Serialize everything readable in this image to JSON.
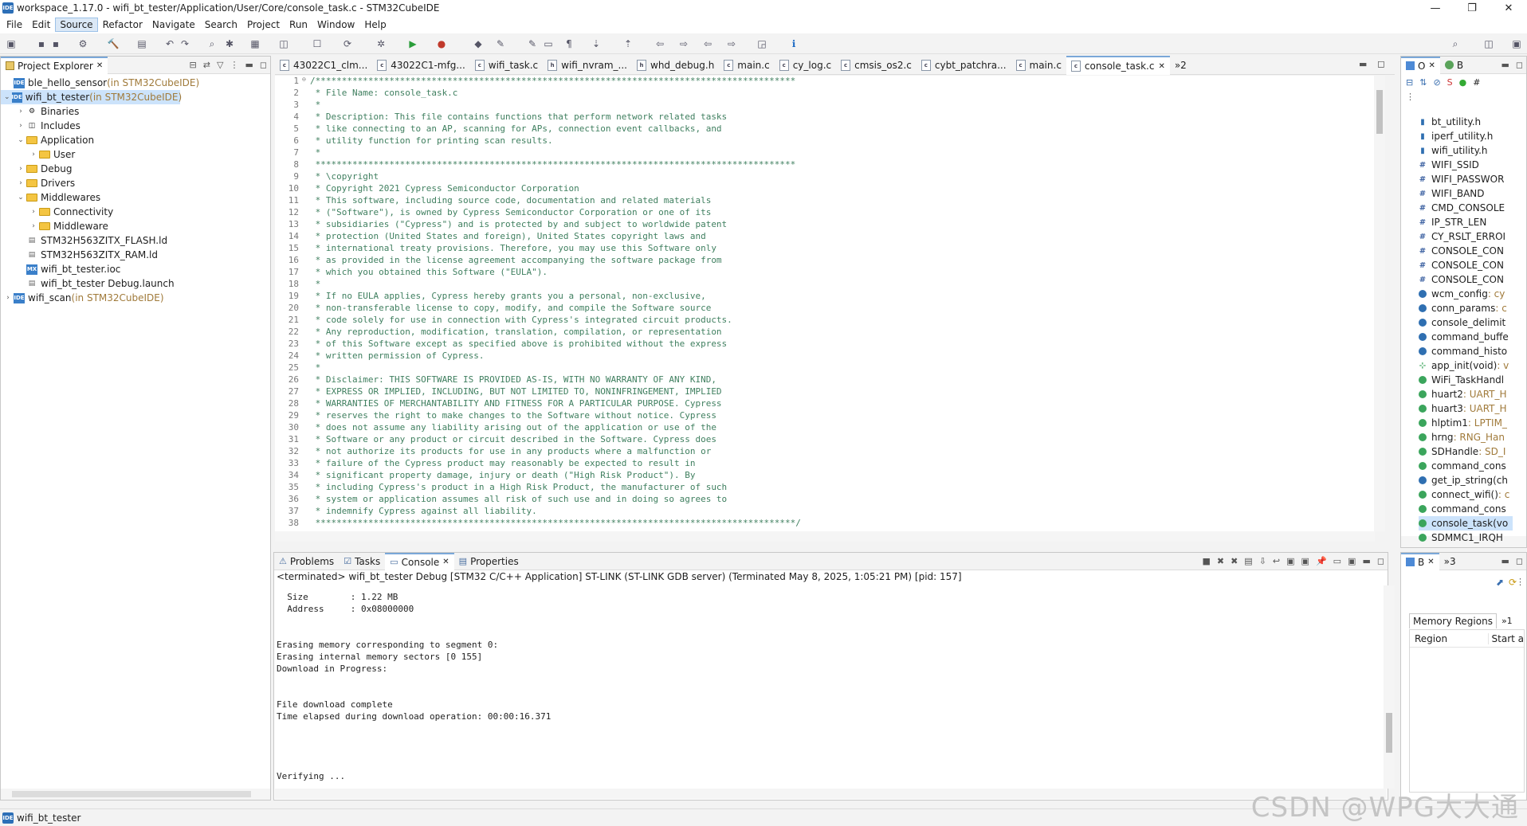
{
  "window": {
    "title": "workspace_1.17.0 - wifi_bt_tester/Application/User/Core/console_task.c - STM32CubeIDE",
    "app_badge": "IDE",
    "minimize": "—",
    "maximize": "❐",
    "close": "✕"
  },
  "menu": [
    "File",
    "Edit",
    "Source",
    "Refactor",
    "Navigate",
    "Search",
    "Project",
    "Run",
    "Window",
    "Help"
  ],
  "project_explorer": {
    "title": "Project Explorer",
    "items": [
      {
        "label": "ble_hello_sensor",
        "suffix": " (in STM32CubeIDE)",
        "depth": 0,
        "kind": "project",
        "expander": ""
      },
      {
        "label": "wifi_bt_tester",
        "suffix": " (in STM32CubeIDE)",
        "depth": 0,
        "kind": "project",
        "expander": "⌄",
        "selected": true
      },
      {
        "label": "Binaries",
        "suffix": "",
        "depth": 1,
        "kind": "bin",
        "expander": "›"
      },
      {
        "label": "Includes",
        "suffix": "",
        "depth": 1,
        "kind": "inc",
        "expander": "›"
      },
      {
        "label": "Application",
        "suffix": "",
        "depth": 1,
        "kind": "folder",
        "expander": "⌄"
      },
      {
        "label": "User",
        "suffix": "",
        "depth": 2,
        "kind": "folder",
        "expander": "›"
      },
      {
        "label": "Debug",
        "suffix": "",
        "depth": 1,
        "kind": "folder",
        "expander": "›"
      },
      {
        "label": "Drivers",
        "suffix": "",
        "depth": 1,
        "kind": "folder",
        "expander": "›"
      },
      {
        "label": "Middlewares",
        "suffix": "",
        "depth": 1,
        "kind": "folder",
        "expander": "⌄"
      },
      {
        "label": "Connectivity",
        "suffix": "",
        "depth": 2,
        "kind": "folder",
        "expander": "›"
      },
      {
        "label": "Middleware",
        "suffix": "",
        "depth": 2,
        "kind": "folder",
        "expander": "›"
      },
      {
        "label": "STM32H563ZITX_FLASH.ld",
        "suffix": "",
        "depth": 1,
        "kind": "file",
        "expander": ""
      },
      {
        "label": "STM32H563ZITX_RAM.ld",
        "suffix": "",
        "depth": 1,
        "kind": "file",
        "expander": ""
      },
      {
        "label": "wifi_bt_tester.ioc",
        "suffix": "",
        "depth": 1,
        "kind": "mx",
        "expander": ""
      },
      {
        "label": "wifi_bt_tester Debug.launch",
        "suffix": "",
        "depth": 1,
        "kind": "file",
        "expander": ""
      },
      {
        "label": "wifi_scan",
        "suffix": " (in STM32CubeIDE)",
        "depth": 0,
        "kind": "project",
        "expander": "›"
      }
    ]
  },
  "editor": {
    "tabs": [
      {
        "label": "43022C1_clm...",
        "kind": "c"
      },
      {
        "label": "43022C1-mfg...",
        "kind": "c"
      },
      {
        "label": "wifi_task.c",
        "kind": "c"
      },
      {
        "label": "wifi_nvram_...",
        "kind": "h"
      },
      {
        "label": "whd_debug.h",
        "kind": "h"
      },
      {
        "label": "main.c",
        "kind": "c"
      },
      {
        "label": "cy_log.c",
        "kind": "c"
      },
      {
        "label": "cmsis_os2.c",
        "kind": "c"
      },
      {
        "label": "cybt_patchra...",
        "kind": "c"
      },
      {
        "label": "main.c",
        "kind": "c"
      },
      {
        "label": "console_task.c",
        "kind": "c",
        "active": true
      }
    ],
    "overflow": "»2",
    "lines": [
      {
        "n": "1",
        "fold": "⊖",
        "text": "/*******************************************************************************************"
      },
      {
        "n": "2",
        "text": " * File Name: console_task.c"
      },
      {
        "n": "3",
        "text": " *"
      },
      {
        "n": "4",
        "text": " * Description: This file contains functions that perform network related tasks"
      },
      {
        "n": "5",
        "text": " * like connecting to an AP, scanning for APs, connection event callbacks, and"
      },
      {
        "n": "6",
        "text": " * utility function for printing scan results."
      },
      {
        "n": "7",
        "text": " *"
      },
      {
        "n": "8",
        "text": " *******************************************************************************************"
      },
      {
        "n": "9",
        "text": " * \\copyright"
      },
      {
        "n": "10",
        "text": " * Copyright 2021 Cypress Semiconductor Corporation"
      },
      {
        "n": "11",
        "text": " * This software, including source code, documentation and related materials"
      },
      {
        "n": "12",
        "text": " * (\"Software\"), is owned by Cypress Semiconductor Corporation or one of its"
      },
      {
        "n": "13",
        "text": " * subsidiaries (\"Cypress\") and is protected by and subject to worldwide patent"
      },
      {
        "n": "14",
        "text": " * protection (United States and foreign), United States copyright laws and"
      },
      {
        "n": "15",
        "text": " * international treaty provisions. Therefore, you may use this Software only"
      },
      {
        "n": "16",
        "text": " * as provided in the license agreement accompanying the software package from"
      },
      {
        "n": "17",
        "text": " * which you obtained this Software (\"EULA\")."
      },
      {
        "n": "18",
        "text": " *"
      },
      {
        "n": "19",
        "text": " * If no EULA applies, Cypress hereby grants you a personal, non-exclusive,"
      },
      {
        "n": "20",
        "text": " * non-transferable license to copy, modify, and compile the Software source"
      },
      {
        "n": "21",
        "text": " * code solely for use in connection with Cypress's integrated circuit products."
      },
      {
        "n": "22",
        "text": " * Any reproduction, modification, translation, compilation, or representation"
      },
      {
        "n": "23",
        "text": " * of this Software except as specified above is prohibited without the express"
      },
      {
        "n": "24",
        "text": " * written permission of Cypress."
      },
      {
        "n": "25",
        "text": " *"
      },
      {
        "n": "26",
        "text": " * Disclaimer: THIS SOFTWARE IS PROVIDED AS-IS, WITH NO WARRANTY OF ANY KIND,"
      },
      {
        "n": "27",
        "text": " * EXPRESS OR IMPLIED, INCLUDING, BUT NOT LIMITED TO, NONINFRINGEMENT, IMPLIED"
      },
      {
        "n": "28",
        "text": " * WARRANTIES OF MERCHANTABILITY AND FITNESS FOR A PARTICULAR PURPOSE. Cypress"
      },
      {
        "n": "29",
        "text": " * reserves the right to make changes to the Software without notice. Cypress"
      },
      {
        "n": "30",
        "text": " * does not assume any liability arising out of the application or use of the"
      },
      {
        "n": "31",
        "text": " * Software or any product or circuit described in the Software. Cypress does"
      },
      {
        "n": "32",
        "text": " * not authorize its products for use in any products where a malfunction or"
      },
      {
        "n": "33",
        "text": " * failure of the Cypress product may reasonably be expected to result in"
      },
      {
        "n": "34",
        "text": " * significant property damage, injury or death (\"High Risk Product\"). By"
      },
      {
        "n": "35",
        "text": " * including Cypress's product in a High Risk Product, the manufacturer of such"
      },
      {
        "n": "36",
        "text": " * system or application assumes all risk of such use and in doing so agrees to"
      },
      {
        "n": "37",
        "text": " * indemnify Cypress against all liability."
      },
      {
        "n": "38",
        "text": " *******************************************************************************************/"
      }
    ]
  },
  "bottom": {
    "tabs": [
      {
        "label": "Problems"
      },
      {
        "label": "Tasks"
      },
      {
        "label": "Console",
        "active": true
      },
      {
        "label": "Properties"
      }
    ],
    "console_header": "<terminated> wifi_bt_tester Debug [STM32 C/C++ Application] ST-LINK (ST-LINK GDB server) (Terminated May 8, 2025, 1:05:21 PM) [pid: 157]",
    "lines": [
      "  Size        : 1.22 MB",
      "  Address     : 0x08000000",
      "",
      "",
      "Erasing memory corresponding to segment 0:",
      "Erasing internal memory sectors [0 155]",
      "Download in Progress:",
      "",
      "",
      "File download complete",
      "Time elapsed during download operation: 00:00:16.371",
      "",
      "",
      "",
      "",
      "Verifying ..."
    ]
  },
  "outline": {
    "tab1": "O",
    "tab2": "B",
    "items": [
      {
        "icon": "h",
        "name": "bt_utility.h",
        "type": ""
      },
      {
        "icon": "h",
        "name": "iperf_utility.h",
        "type": ""
      },
      {
        "icon": "h",
        "name": "wifi_utility.h",
        "type": ""
      },
      {
        "icon": "#",
        "name": "WIFI_SSID",
        "type": ""
      },
      {
        "icon": "#",
        "name": "WIFI_PASSWOR",
        "type": ""
      },
      {
        "icon": "#",
        "name": "WIFI_BAND",
        "type": ""
      },
      {
        "icon": "#",
        "name": "CMD_CONSOLE",
        "type": ""
      },
      {
        "icon": "#",
        "name": "IP_STR_LEN",
        "type": ""
      },
      {
        "icon": "#",
        "name": "CY_RSLT_ERROI",
        "type": ""
      },
      {
        "icon": "#",
        "name": "CONSOLE_CON",
        "type": ""
      },
      {
        "icon": "#",
        "name": "CONSOLE_CON",
        "type": ""
      },
      {
        "icon": "#",
        "name": "CONSOLE_CON",
        "type": ""
      },
      {
        "icon": "s",
        "name": "wcm_config",
        "type": " : cy"
      },
      {
        "icon": "s",
        "name": "conn_params",
        "type": " : c"
      },
      {
        "icon": "c",
        "name": "console_delimit",
        "type": ""
      },
      {
        "icon": "s",
        "name": "command_buffe",
        "type": ""
      },
      {
        "icon": "s",
        "name": "command_histo",
        "type": ""
      },
      {
        "icon": "f",
        "name": "app_init(void)",
        "type": " : v"
      },
      {
        "icon": "g",
        "name": "WiFi_TaskHandl",
        "type": ""
      },
      {
        "icon": "g",
        "name": "huart2",
        "type": " : UART_H"
      },
      {
        "icon": "g",
        "name": "huart3",
        "type": " : UART_H"
      },
      {
        "icon": "g",
        "name": "hlptim1",
        "type": " : LPTIM_"
      },
      {
        "icon": "g",
        "name": "hrng",
        "type": " : RNG_Han"
      },
      {
        "icon": "g",
        "name": "SDHandle",
        "type": " : SD_I"
      },
      {
        "icon": "g",
        "name": "command_cons",
        "type": ""
      },
      {
        "icon": "s",
        "name": "get_ip_string(ch",
        "type": ""
      },
      {
        "icon": "g",
        "name": "connect_wifi()",
        "type": " : c"
      },
      {
        "icon": "g",
        "name": "command_cons",
        "type": ""
      },
      {
        "icon": "g",
        "name": "console_task(vo",
        "type": "",
        "selected": true
      },
      {
        "icon": "g",
        "name": "SDMMC1_IRQH",
        "type": ""
      }
    ]
  },
  "memory": {
    "tab": "B",
    "tab2": "»3",
    "regions_tab": "Memory Regions",
    "overflow": "»1",
    "col_region": "Region",
    "col_start": "Start a"
  },
  "status": {
    "project": "wifi_bt_tester",
    "badge": "IDE"
  },
  "watermark": "CSDN @WPG大大通",
  "colors": {
    "selection": "#cce3fb",
    "comment": "#3f7f5f",
    "accent": "#7aa7d8"
  }
}
